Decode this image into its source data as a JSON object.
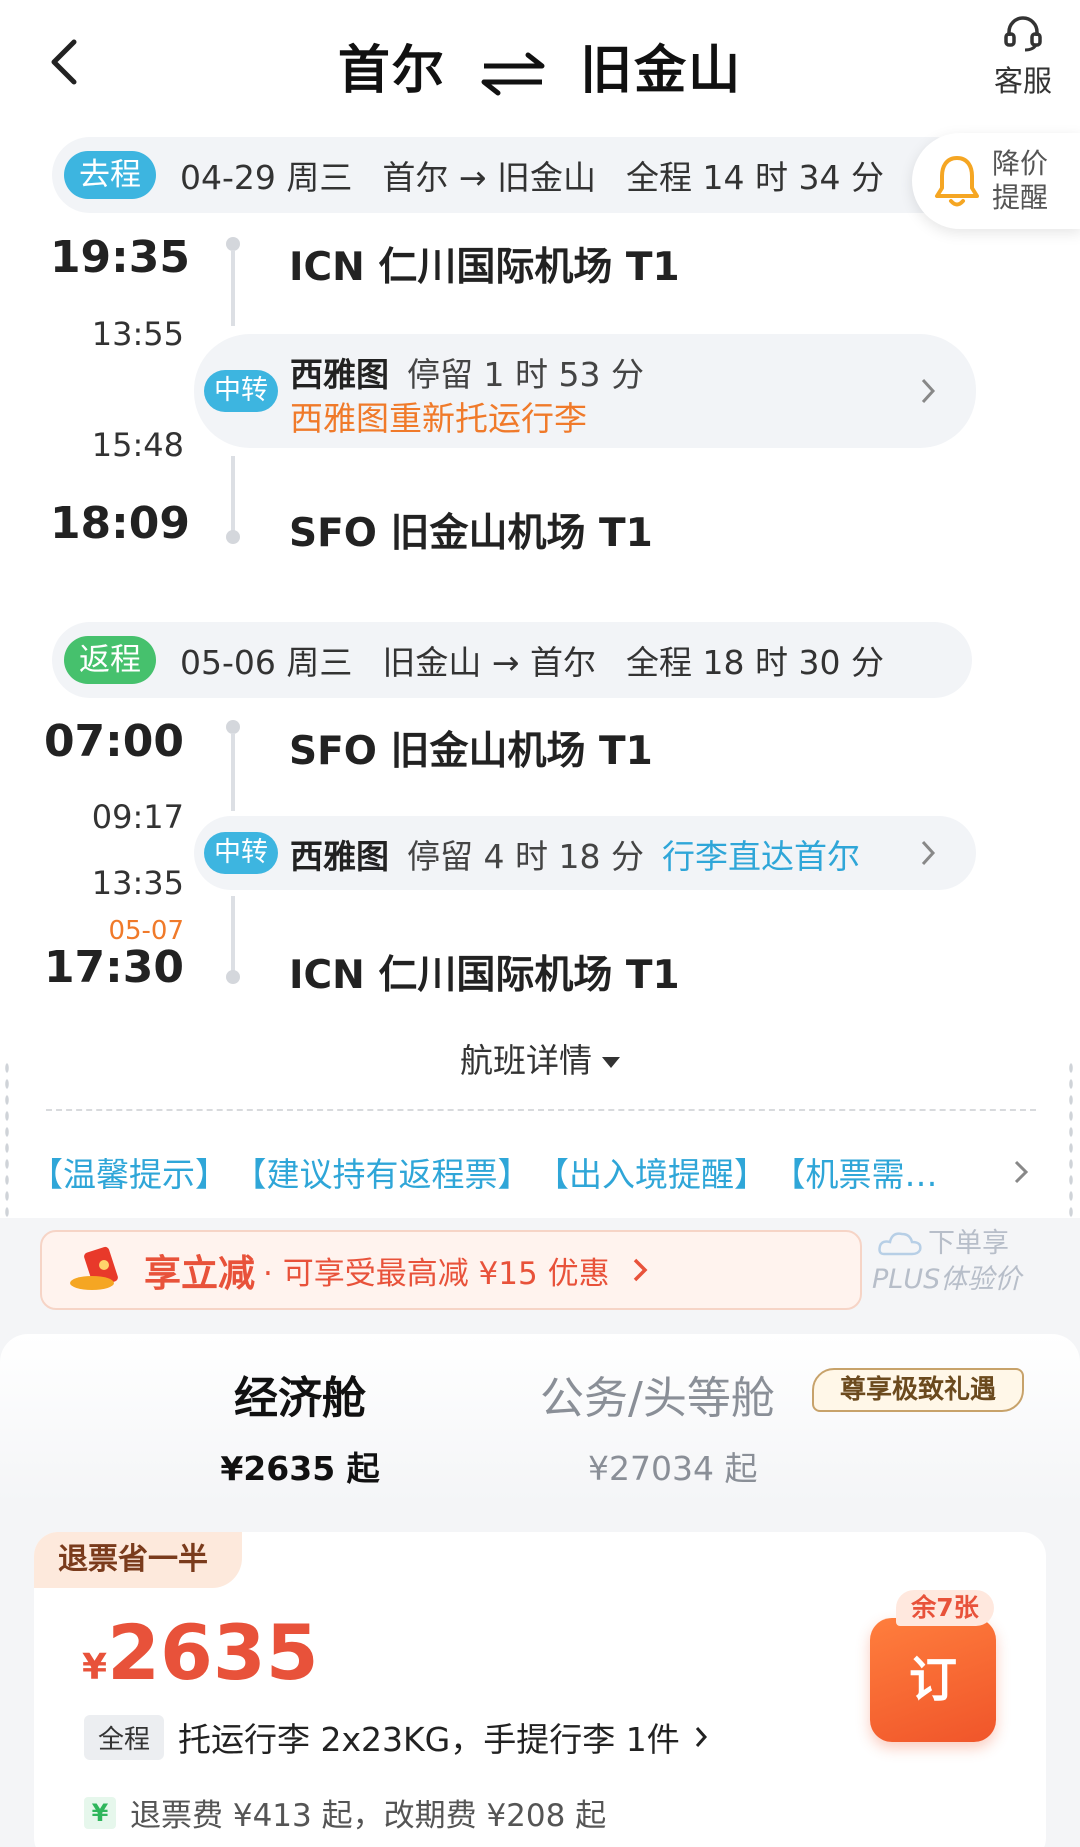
{
  "header": {
    "title_from": "首尔",
    "title_to": "旧金山",
    "service_label": "客服"
  },
  "outbound": {
    "tag": "去程",
    "date": "04-29 周三",
    "route": "首尔 → 旧金山",
    "duration": "全程 14 时 34 分",
    "depart_time": "19:35",
    "depart_airport": "ICN 仁川国际机场 T1",
    "transfer_arrive": "13:55",
    "transfer_depart": "15:48",
    "transfer_tag": "中转",
    "transfer_city": "西雅图",
    "transfer_stay": "停留 1 时 53 分",
    "transfer_note": "西雅图重新托运行李",
    "arrive_time": "18:09",
    "arrive_airport": "SFO 旧金山机场 T1"
  },
  "price_alert": {
    "line1": "降价",
    "line2": "提醒"
  },
  "return": {
    "tag": "返程",
    "date": "05-06 周三",
    "route": "旧金山 → 首尔",
    "duration": "全程 18 时 30 分",
    "depart_time": "07:00",
    "depart_airport": "SFO 旧金山机场 T1",
    "transfer_arrive": "09:17",
    "transfer_depart": "13:35",
    "transfer_tag": "中转",
    "transfer_city": "西雅图",
    "transfer_stay": "停留 4 时 18 分",
    "transfer_note": "行李直达首尔",
    "arrive_date": "05-07",
    "arrive_time": "17:30",
    "arrive_airport": "ICN 仁川国际机场 T1"
  },
  "details_label": "航班详情",
  "tips": [
    "【温馨提示】",
    "【建议持有返程票】",
    "【出入境提醒】",
    "【机票需…"
  ],
  "promo": {
    "main": "享立减",
    "sub": "· 可享受最高减 ¥15 优惠",
    "plus_line1": "下单享",
    "plus_line2": "PLUS体验价"
  },
  "cabins": {
    "economy_name": "经济舱",
    "economy_price": "¥2635 起",
    "business_name": "公务/头等舱",
    "business_price": "¥27034 起",
    "vip_badge": "尊享极致礼遇"
  },
  "fare": {
    "refund_badge": "退票省一半",
    "currency": "¥",
    "price": "2635",
    "remaining": "余7张",
    "book_label": "订",
    "baggage_tag": "全程",
    "baggage_text": "托运行李 2x23KG，手提行李 1件",
    "refund_icon": "¥",
    "refund_text": "退票费 ¥413 起，改期费 ¥208 起"
  },
  "colors": {
    "accent_blue": "#3db5e0",
    "accent_green": "#46c16d",
    "accent_orange": "#f07a2a",
    "price_red": "#e8523a"
  }
}
